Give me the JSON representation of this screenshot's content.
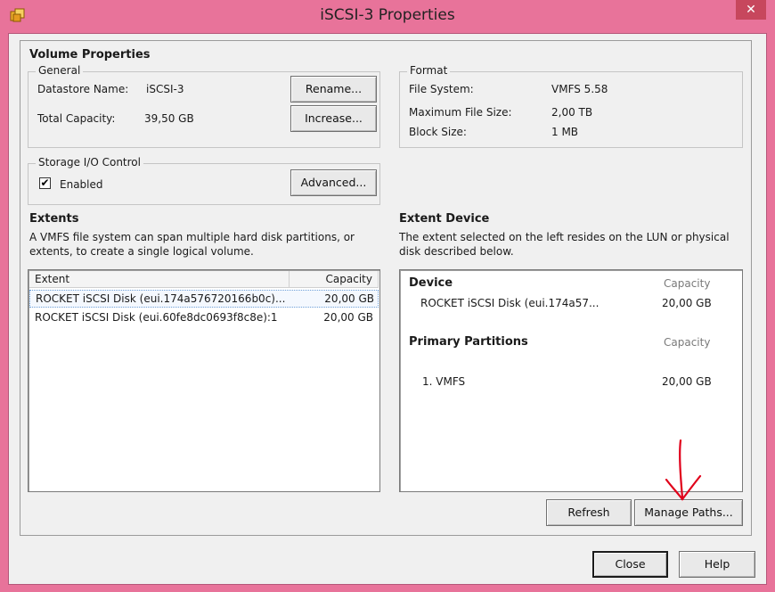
{
  "window": {
    "title": "iSCSI-3 Properties"
  },
  "volume_properties": {
    "heading": "Volume Properties",
    "general": {
      "legend": "General",
      "datastore_name_label": "Datastore Name:",
      "datastore_name_value": "iSCSI-3",
      "total_capacity_label": "Total Capacity:",
      "total_capacity_value": "39,50 GB",
      "rename_button": "Rename...",
      "increase_button": "Increase..."
    },
    "format": {
      "legend": "Format",
      "file_system_label": "File System:",
      "file_system_value": "VMFS 5.58",
      "max_file_size_label": "Maximum File Size:",
      "max_file_size_value": "2,00 TB",
      "block_size_label": "Block Size:",
      "block_size_value": "1 MB"
    },
    "storage_io": {
      "legend": "Storage I/O Control",
      "enabled_label": "Enabled",
      "enabled_checked": true,
      "advanced_button": "Advanced..."
    }
  },
  "extents": {
    "heading": "Extents",
    "description_line1": "A VMFS file system can span multiple hard disk partitions, or",
    "description_line2": "extents, to create a single logical volume.",
    "columns": [
      "Extent",
      "Capacity"
    ],
    "rows": [
      {
        "extent": "ROCKET iSCSI Disk (eui.174a576720166b0c)...",
        "capacity": "20,00 GB",
        "selected": true
      },
      {
        "extent": "ROCKET iSCSI Disk (eui.60fe8dc0693f8c8e):1",
        "capacity": "20,00 GB",
        "selected": false
      }
    ]
  },
  "extent_device": {
    "heading": "Extent Device",
    "description_line1": "The extent selected on the left resides on the LUN or physical",
    "description_line2": "disk described below.",
    "device_header": "Device",
    "capacity_header": "Capacity",
    "device_name": "ROCKET iSCSI Disk (eui.174a57...",
    "device_capacity": "20,00 GB",
    "partitions_header": "Primary Partitions",
    "partitions_capacity_header": "Capacity",
    "partitions": [
      {
        "name": "1. VMFS",
        "capacity": "20,00 GB"
      }
    ],
    "refresh_button": "Refresh",
    "manage_paths_button": "Manage Paths..."
  },
  "footer": {
    "close_button": "Close",
    "help_button": "Help"
  },
  "colors": {
    "window_frame": "#e8739a",
    "client_bg": "#f0f0f0",
    "annotation_arrow": "#e0001a"
  },
  "icons": [
    "vsphere-app-icon",
    "close-icon",
    "checkbox-checked",
    "red-arrow-annotation"
  ]
}
